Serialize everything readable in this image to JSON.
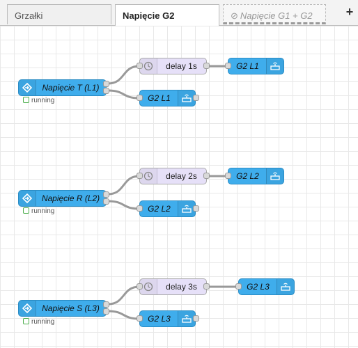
{
  "tabs": [
    {
      "label": "Grzałki",
      "state": "normal"
    },
    {
      "label": "Napięcie G2",
      "state": "active"
    },
    {
      "label": "Napięcie G1 + G2",
      "state": "disabled"
    }
  ],
  "add_tab_label": "+",
  "nodes": {
    "inject_1": "Napięcie T (L1)",
    "inject_2": "Napięcie R (L2)",
    "inject_3": "Napięcie S (L3)",
    "delay_1": "delay 1s",
    "delay_2": "delay 2s",
    "delay_3": "delay 3s",
    "out_1a": "G2 L1",
    "out_1b": "G2 L1",
    "out_2a": "G2 L2",
    "out_2b": "G2 L2",
    "out_3a": "G2 L3",
    "out_3b": "G2 L3"
  },
  "status_text": "running",
  "colors": {
    "node_blue": "#3fadec",
    "node_delay": "#e6e0f8",
    "status_green": "#4cae4c",
    "wire": "#999999"
  }
}
